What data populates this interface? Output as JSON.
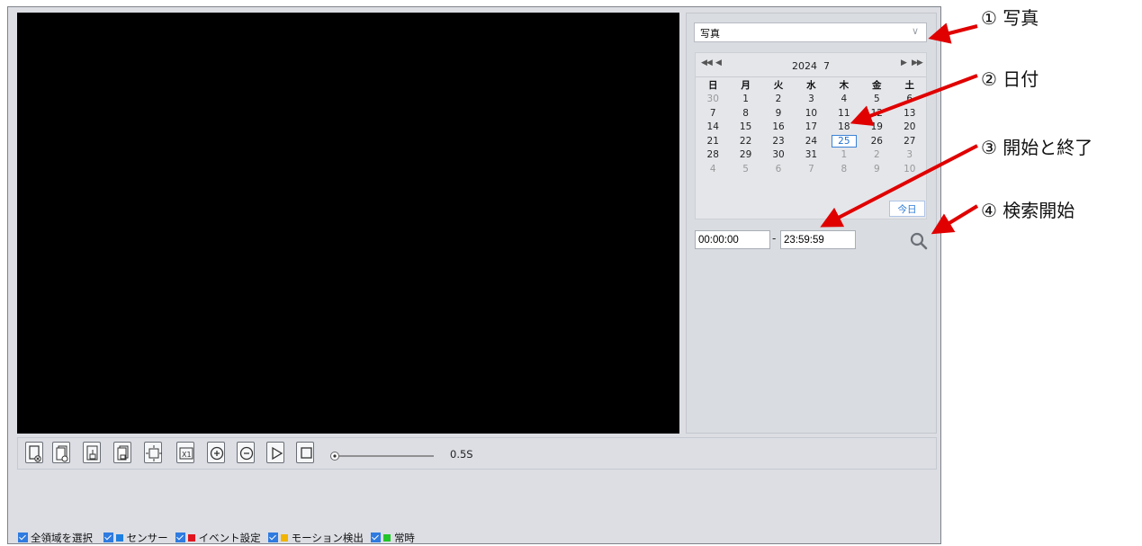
{
  "type_select": {
    "value": "写真"
  },
  "calendar": {
    "year": "2024",
    "month": "7",
    "nav_prev_year": "◀◀",
    "nav_prev_month": "◀",
    "nav_next_month": "▶",
    "nav_next_year": "▶▶",
    "weekdays": [
      "日",
      "月",
      "火",
      "水",
      "木",
      "金",
      "土"
    ],
    "weeks": [
      [
        "30",
        "1",
        "2",
        "3",
        "4",
        "5",
        "6"
      ],
      [
        "7",
        "8",
        "9",
        "10",
        "11",
        "12",
        "13"
      ],
      [
        "14",
        "15",
        "16",
        "17",
        "18",
        "19",
        "20"
      ],
      [
        "21",
        "22",
        "23",
        "24",
        "25",
        "26",
        "27"
      ],
      [
        "28",
        "29",
        "30",
        "31",
        "1",
        "2",
        "3"
      ],
      [
        "4",
        "5",
        "6",
        "7",
        "8",
        "9",
        "10"
      ]
    ],
    "selected_day": "25",
    "today_label": "今日"
  },
  "time_range": {
    "start": "00:00:00",
    "separator": "-",
    "end": "23:59:59"
  },
  "playback": {
    "speed": "0.5S",
    "slider_position": 0.0
  },
  "legend": {
    "select_all": "全領域を選択",
    "items": [
      {
        "label": "センサー",
        "color": "#1e7fe0"
      },
      {
        "label": "イベント設定",
        "color": "#e0141e"
      },
      {
        "label": "モーション検出",
        "color": "#f2b400"
      },
      {
        "label": "常時",
        "color": "#22c52a"
      }
    ]
  },
  "callouts": [
    {
      "number": "①",
      "text": "写真"
    },
    {
      "number": "②",
      "text": "日付"
    },
    {
      "number": "③",
      "text": "開始と終了"
    },
    {
      "number": "④",
      "text": "検索開始"
    }
  ],
  "colors": {
    "arrow": "#e00000",
    "accent": "#2f7be0",
    "video_bg": "#000000"
  },
  "toolbar_icons": [
    "stop-all-clip-icon",
    "close-all-clip-icon",
    "download-clip-icon",
    "download-all-icon",
    "fullscreen-icon",
    "original-size-icon",
    "zoom-in-icon",
    "zoom-out-icon",
    "play-icon",
    "stop-icon"
  ]
}
